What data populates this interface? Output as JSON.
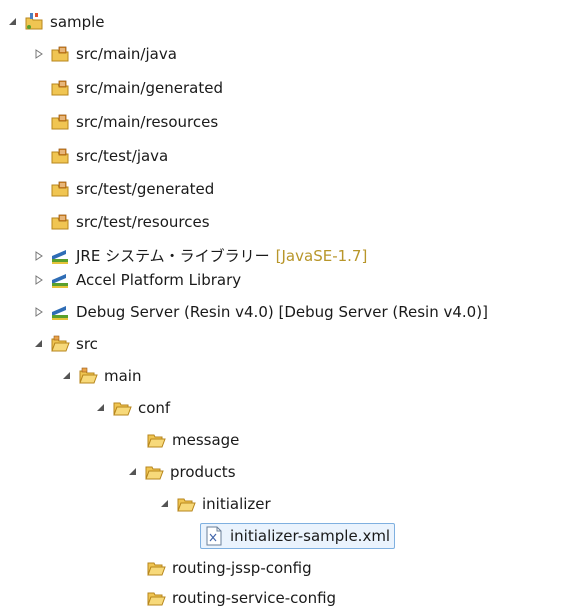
{
  "tree": {
    "project": {
      "label": "sample"
    },
    "source_folders": [
      {
        "label": "src/main/java"
      },
      {
        "label": "src/main/generated"
      },
      {
        "label": "src/main/resources"
      },
      {
        "label": "src/test/java"
      },
      {
        "label": "src/test/generated"
      },
      {
        "label": "src/test/resources"
      }
    ],
    "libraries": [
      {
        "label": "JRE システム・ライブラリー",
        "decoration": "[JavaSE-1.7]"
      },
      {
        "label": "Accel Platform Library"
      },
      {
        "label": "Debug Server (Resin v4.0) [Debug Server (Resin v4.0)]"
      }
    ],
    "folders": {
      "src": "src",
      "main": "main",
      "conf": "conf",
      "message": "message",
      "products": "products",
      "initializer": "initializer",
      "routing_jssp_config": "routing-jssp-config",
      "routing_service_config": "routing-service-config"
    },
    "file": {
      "label": "initializer-sample.xml",
      "selected": true
    }
  },
  "colors": {
    "folder": "#f0c552",
    "folder_stroke": "#b7861c",
    "package_folder": "#e8a24a",
    "library_blue": "#2f6db5",
    "library_green": "#5aa02c",
    "library_yellow": "#e6c33b",
    "selection_bg": "#eaf3fd",
    "selection_border": "#7fb0e0",
    "decoration": "#b8962a"
  }
}
